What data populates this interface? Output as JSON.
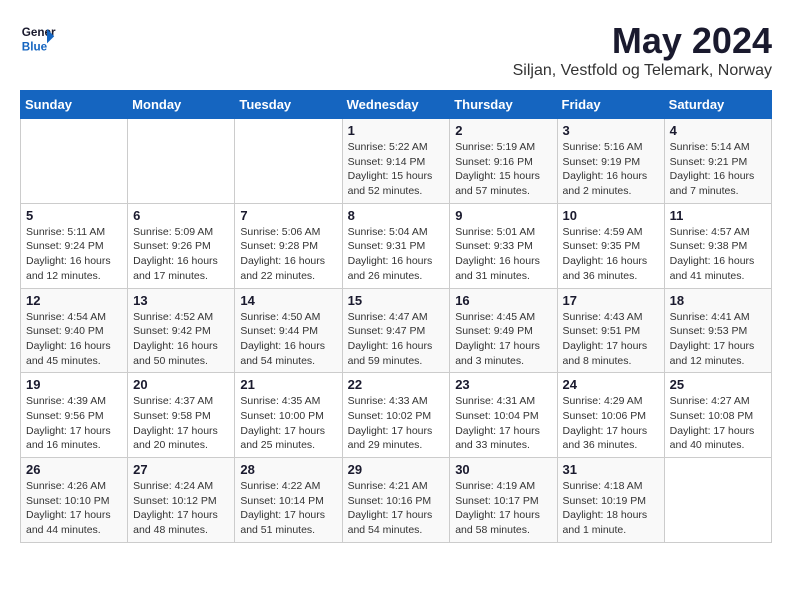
{
  "header": {
    "logo_line1": "General",
    "logo_line2": "Blue",
    "month": "May 2024",
    "location": "Siljan, Vestfold og Telemark, Norway"
  },
  "weekdays": [
    "Sunday",
    "Monday",
    "Tuesday",
    "Wednesday",
    "Thursday",
    "Friday",
    "Saturday"
  ],
  "weeks": [
    [
      {
        "day": "",
        "info": ""
      },
      {
        "day": "",
        "info": ""
      },
      {
        "day": "",
        "info": ""
      },
      {
        "day": "1",
        "info": "Sunrise: 5:22 AM\nSunset: 9:14 PM\nDaylight: 15 hours and 52 minutes."
      },
      {
        "day": "2",
        "info": "Sunrise: 5:19 AM\nSunset: 9:16 PM\nDaylight: 15 hours and 57 minutes."
      },
      {
        "day": "3",
        "info": "Sunrise: 5:16 AM\nSunset: 9:19 PM\nDaylight: 16 hours and 2 minutes."
      },
      {
        "day": "4",
        "info": "Sunrise: 5:14 AM\nSunset: 9:21 PM\nDaylight: 16 hours and 7 minutes."
      }
    ],
    [
      {
        "day": "5",
        "info": "Sunrise: 5:11 AM\nSunset: 9:24 PM\nDaylight: 16 hours and 12 minutes."
      },
      {
        "day": "6",
        "info": "Sunrise: 5:09 AM\nSunset: 9:26 PM\nDaylight: 16 hours and 17 minutes."
      },
      {
        "day": "7",
        "info": "Sunrise: 5:06 AM\nSunset: 9:28 PM\nDaylight: 16 hours and 22 minutes."
      },
      {
        "day": "8",
        "info": "Sunrise: 5:04 AM\nSunset: 9:31 PM\nDaylight: 16 hours and 26 minutes."
      },
      {
        "day": "9",
        "info": "Sunrise: 5:01 AM\nSunset: 9:33 PM\nDaylight: 16 hours and 31 minutes."
      },
      {
        "day": "10",
        "info": "Sunrise: 4:59 AM\nSunset: 9:35 PM\nDaylight: 16 hours and 36 minutes."
      },
      {
        "day": "11",
        "info": "Sunrise: 4:57 AM\nSunset: 9:38 PM\nDaylight: 16 hours and 41 minutes."
      }
    ],
    [
      {
        "day": "12",
        "info": "Sunrise: 4:54 AM\nSunset: 9:40 PM\nDaylight: 16 hours and 45 minutes."
      },
      {
        "day": "13",
        "info": "Sunrise: 4:52 AM\nSunset: 9:42 PM\nDaylight: 16 hours and 50 minutes."
      },
      {
        "day": "14",
        "info": "Sunrise: 4:50 AM\nSunset: 9:44 PM\nDaylight: 16 hours and 54 minutes."
      },
      {
        "day": "15",
        "info": "Sunrise: 4:47 AM\nSunset: 9:47 PM\nDaylight: 16 hours and 59 minutes."
      },
      {
        "day": "16",
        "info": "Sunrise: 4:45 AM\nSunset: 9:49 PM\nDaylight: 17 hours and 3 minutes."
      },
      {
        "day": "17",
        "info": "Sunrise: 4:43 AM\nSunset: 9:51 PM\nDaylight: 17 hours and 8 minutes."
      },
      {
        "day": "18",
        "info": "Sunrise: 4:41 AM\nSunset: 9:53 PM\nDaylight: 17 hours and 12 minutes."
      }
    ],
    [
      {
        "day": "19",
        "info": "Sunrise: 4:39 AM\nSunset: 9:56 PM\nDaylight: 17 hours and 16 minutes."
      },
      {
        "day": "20",
        "info": "Sunrise: 4:37 AM\nSunset: 9:58 PM\nDaylight: 17 hours and 20 minutes."
      },
      {
        "day": "21",
        "info": "Sunrise: 4:35 AM\nSunset: 10:00 PM\nDaylight: 17 hours and 25 minutes."
      },
      {
        "day": "22",
        "info": "Sunrise: 4:33 AM\nSunset: 10:02 PM\nDaylight: 17 hours and 29 minutes."
      },
      {
        "day": "23",
        "info": "Sunrise: 4:31 AM\nSunset: 10:04 PM\nDaylight: 17 hours and 33 minutes."
      },
      {
        "day": "24",
        "info": "Sunrise: 4:29 AM\nSunset: 10:06 PM\nDaylight: 17 hours and 36 minutes."
      },
      {
        "day": "25",
        "info": "Sunrise: 4:27 AM\nSunset: 10:08 PM\nDaylight: 17 hours and 40 minutes."
      }
    ],
    [
      {
        "day": "26",
        "info": "Sunrise: 4:26 AM\nSunset: 10:10 PM\nDaylight: 17 hours and 44 minutes."
      },
      {
        "day": "27",
        "info": "Sunrise: 4:24 AM\nSunset: 10:12 PM\nDaylight: 17 hours and 48 minutes."
      },
      {
        "day": "28",
        "info": "Sunrise: 4:22 AM\nSunset: 10:14 PM\nDaylight: 17 hours and 51 minutes."
      },
      {
        "day": "29",
        "info": "Sunrise: 4:21 AM\nSunset: 10:16 PM\nDaylight: 17 hours and 54 minutes."
      },
      {
        "day": "30",
        "info": "Sunrise: 4:19 AM\nSunset: 10:17 PM\nDaylight: 17 hours and 58 minutes."
      },
      {
        "day": "31",
        "info": "Sunrise: 4:18 AM\nSunset: 10:19 PM\nDaylight: 18 hours and 1 minute."
      },
      {
        "day": "",
        "info": ""
      }
    ]
  ]
}
